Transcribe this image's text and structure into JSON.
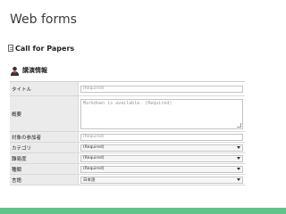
{
  "slide": {
    "title": "Web forms"
  },
  "section": {
    "title": "Call for Papers"
  },
  "subsection": {
    "title": "講演情報"
  },
  "form": {
    "rows": [
      {
        "label": "タイトル",
        "placeholder": "(Required)"
      },
      {
        "label": "概要",
        "placeholder": "Markdown is available. (Required)"
      },
      {
        "label": "対象の参加者",
        "placeholder": "(Required)"
      },
      {
        "label": "カテゴリ",
        "value": "(Required)"
      },
      {
        "label": "難易度",
        "value": "(Required)"
      },
      {
        "label": "種類",
        "value": "(Required)"
      },
      {
        "label": "言語",
        "value": "日本語"
      }
    ]
  },
  "colors": {
    "accent_bar": "#5fc38a",
    "label_bg": "#ebebeb"
  }
}
